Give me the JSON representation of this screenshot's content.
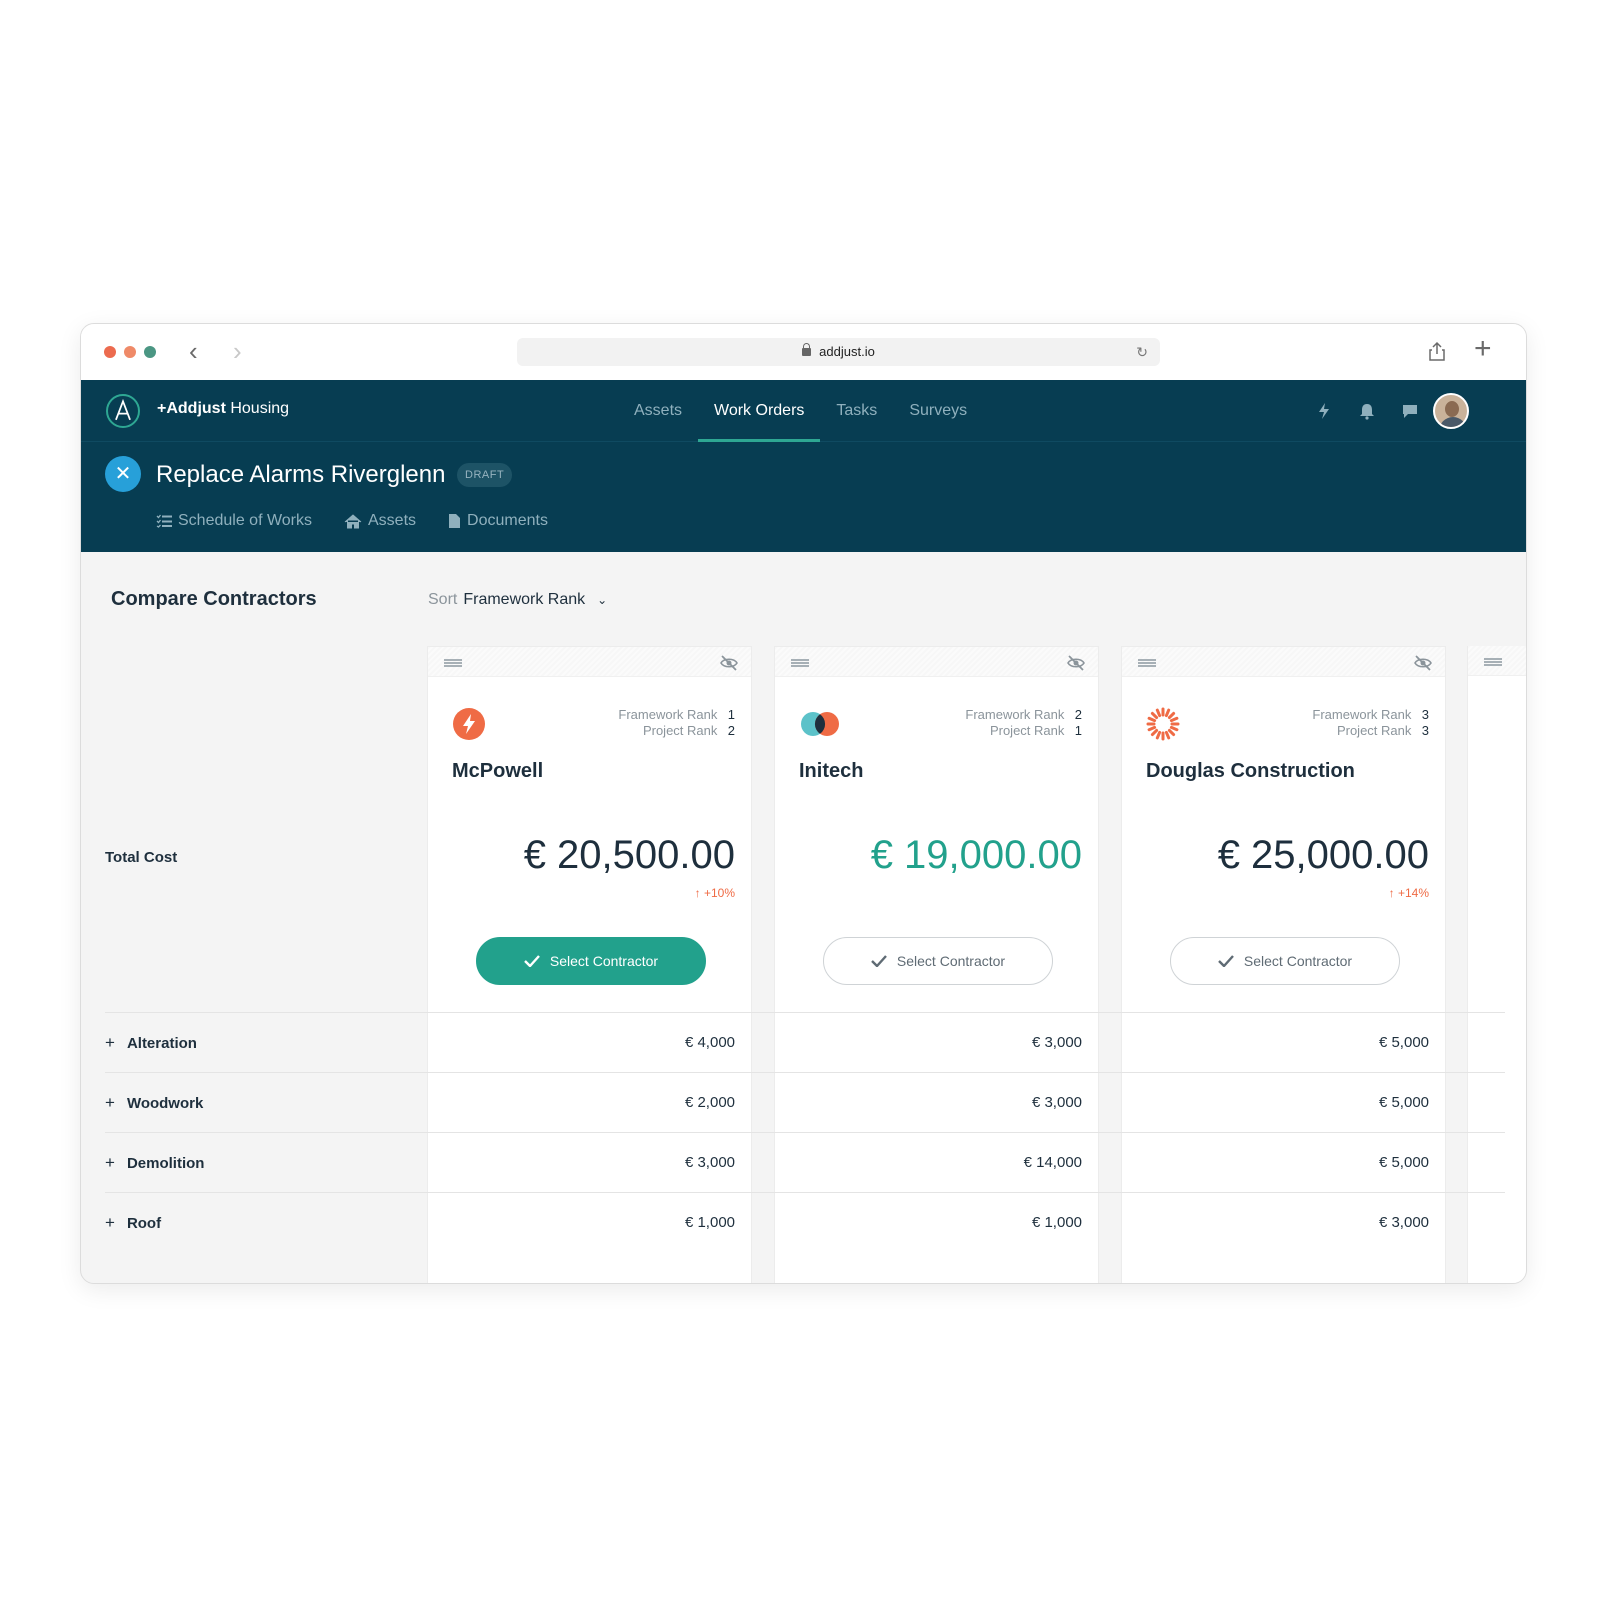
{
  "browser": {
    "url": "addjust.io"
  },
  "app": {
    "brand_bold": "+Addjust",
    "brand_rest": " Housing",
    "nav": [
      {
        "label": "Assets"
      },
      {
        "label": "Work Orders"
      },
      {
        "label": "Tasks"
      },
      {
        "label": "Surveys"
      }
    ],
    "active_nav": "Work Orders"
  },
  "project": {
    "title": "Replace Alarms Riverglenn",
    "status": "DRAFT",
    "tabs": [
      {
        "label": "Schedule of Works",
        "icon": "list-check-icon"
      },
      {
        "label": "Assets",
        "icon": "home-icon"
      },
      {
        "label": "Documents",
        "icon": "document-icon"
      }
    ]
  },
  "compare": {
    "title": "Compare Contractors",
    "sort_label": "Sort",
    "sort_value": "Framework Rank",
    "total_label": "Total Cost",
    "framework_rank_label": "Framework Rank",
    "project_rank_label": "Project Rank",
    "select_label": "Select Contractor",
    "contractors": [
      {
        "name": "McPowell",
        "framework_rank": "1",
        "project_rank": "2",
        "total": "€ 20,500.00",
        "change": "+10%",
        "selected": true
      },
      {
        "name": "Initech",
        "framework_rank": "2",
        "project_rank": "1",
        "total": "€ 19,000.00",
        "change": "",
        "selected": false
      },
      {
        "name": "Douglas Construction",
        "framework_rank": "3",
        "project_rank": "3",
        "total": "€ 25,000.00",
        "change": "+14%",
        "selected": false
      }
    ],
    "rows": [
      {
        "label": "Alteration",
        "values": [
          "€ 4,000",
          "€ 3,000",
          "€ 5,000"
        ]
      },
      {
        "label": "Woodwork",
        "values": [
          "€ 2,000",
          "€ 3,000",
          "€ 5,000"
        ]
      },
      {
        "label": "Demolition",
        "values": [
          "€ 3,000",
          "€ 14,000",
          "€ 5,000"
        ]
      },
      {
        "label": "Roof",
        "values": [
          "€ 1,000",
          "€ 1,000",
          "€ 3,000"
        ]
      }
    ]
  },
  "colors": {
    "header": "#073d52",
    "accent": "#22a18c",
    "increase": "#ef6b45"
  }
}
